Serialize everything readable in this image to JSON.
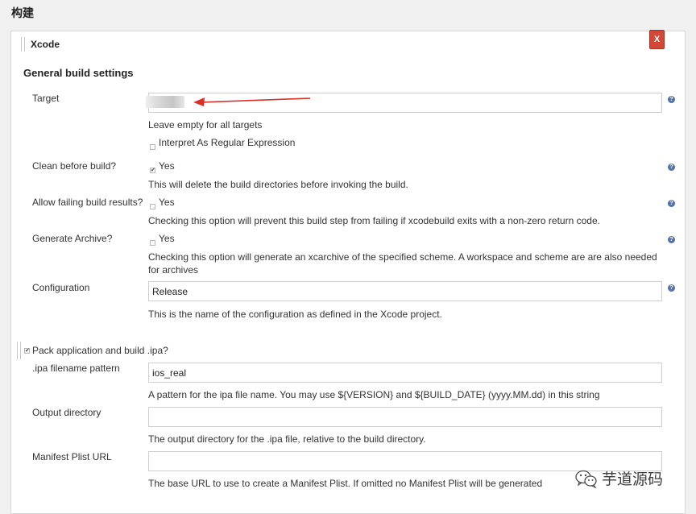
{
  "section": {
    "title": "构建"
  },
  "step": {
    "name": "Xcode",
    "delete_label": "X"
  },
  "general": {
    "title": "General build settings"
  },
  "fields": {
    "target": {
      "label": "Target",
      "value": "",
      "hint": "Leave empty for all targets",
      "regex_label": "Interpret As Regular Expression",
      "regex_checked": false
    },
    "clean": {
      "label": "Clean before build?",
      "option": "Yes",
      "checked": true,
      "hint": "This will delete the build directories before invoking the build."
    },
    "allow_failing": {
      "label": "Allow failing build results?",
      "option": "Yes",
      "checked": false,
      "hint": "Checking this option will prevent this build step from failing if xcodebuild exits with a non-zero return code."
    },
    "archive": {
      "label": "Generate Archive?",
      "option": "Yes",
      "checked": false,
      "hint_line1": "Checking this option will generate an xcarchive of the specified scheme. A workspace and scheme are are also needed",
      "hint_line2": "for archives"
    },
    "configuration": {
      "label": "Configuration",
      "value": "Release",
      "hint": "This is the name of the configuration as defined in the Xcode project."
    }
  },
  "pack": {
    "label": "Pack application and build .ipa?",
    "checked": true,
    "ipa_pattern": {
      "label": ".ipa filename pattern",
      "value": "ios_real",
      "hint": "A pattern for the ipa file name. You may use ${VERSION} and ${BUILD_DATE} (yyyy.MM.dd) in this string"
    },
    "output_dir": {
      "label": "Output directory",
      "value": "",
      "hint": "The output directory for the .ipa file, relative to the build directory."
    },
    "manifest": {
      "label": "Manifest Plist URL",
      "value": "",
      "hint": "The base URL to use to create a Manifest Plist. If omitted no Manifest Plist will be generated"
    }
  },
  "help_glyph": "?",
  "check_glyph": "✔",
  "watermark": {
    "text": "芋道源码",
    "icon": "wechat-icon"
  },
  "colors": {
    "delete_button": "#d14836",
    "help_icon": "#5673a6",
    "annotation_arrow": "#d9322b"
  }
}
